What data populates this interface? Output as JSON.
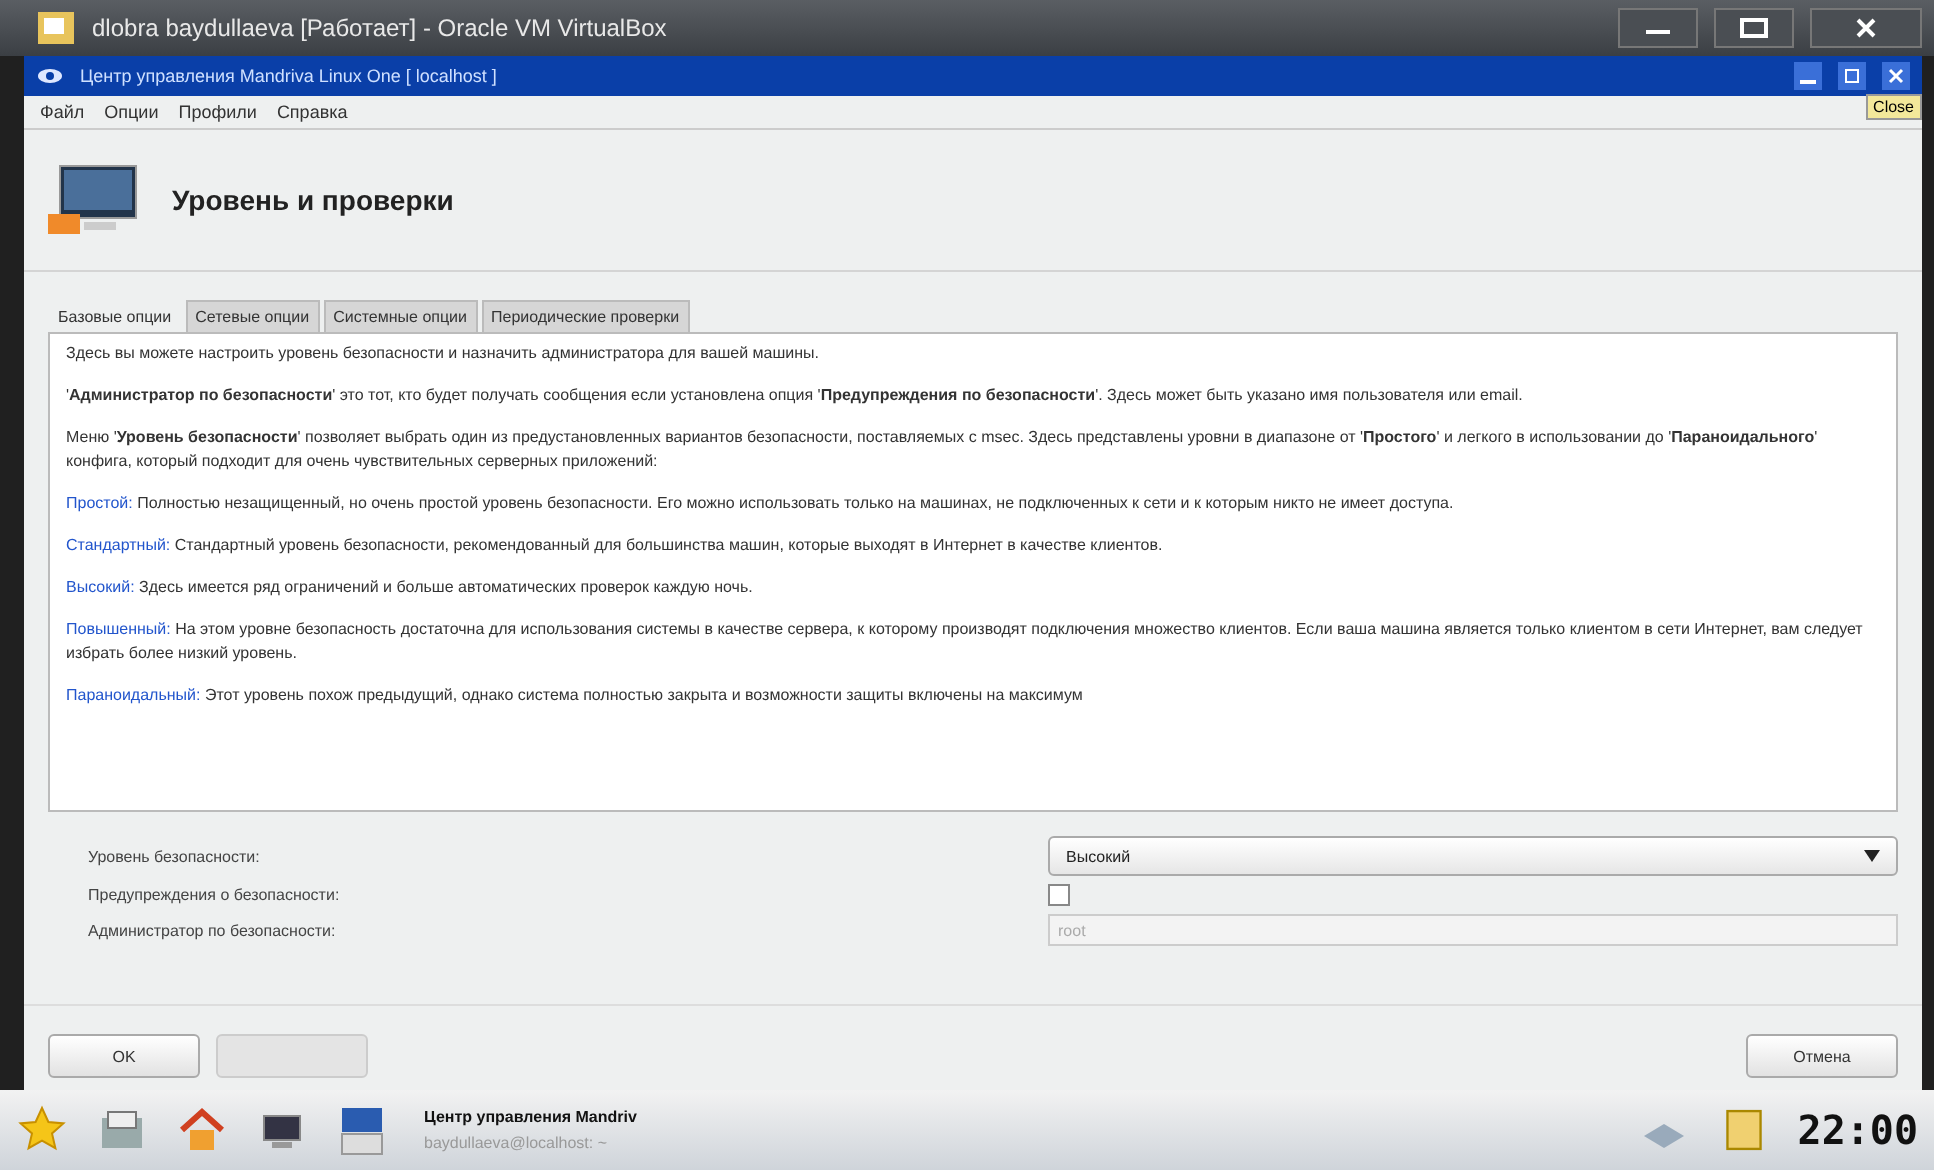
{
  "host_window": {
    "title": "dlobra baydullaeva [Работает] - Oracle VM VirtualBox"
  },
  "window": {
    "title": "Центр управления Mandriva Linux One [ localhost ]",
    "tooltip": "Close"
  },
  "menu": [
    "Файл",
    "Опции",
    "Профили",
    "Справка"
  ],
  "header": {
    "title": "Уровень и проверки"
  },
  "tabs": [
    {
      "label": "Базовые опции",
      "selected": true
    },
    {
      "label": "Сетевые опции",
      "selected": false
    },
    {
      "label": "Системные опции",
      "selected": false
    },
    {
      "label": "Периодические проверки",
      "selected": false
    }
  ],
  "paragraphs": [
    {
      "kind": "text",
      "text": "Здесь вы можете настроить уровень безопасности и назначить администратора для вашей машины."
    },
    {
      "kind": "text",
      "text": "'**Администратор по безопасности**' это тот, кто будет получать сообщения если установлена опция '**Предупреждения по безопасности**'. Здесь может быть указано имя пользователя или email."
    },
    {
      "kind": "text",
      "text": "Меню '**Уровень безопасности**' позволяет выбрать один из предустановленных вариантов безопасности, поставляемых с msec. Здесь представлены уровни в диапазоне от '**Простого**' и легкого в использовании до '**Параноидального**' конфига, который подходит для очень чувствительных серверных приложений:"
    },
    {
      "kind": "level",
      "term": "Простой:",
      "text": "Полностью незащищенный, но очень простой уровень безопасности. Его можно использовать только на машинах, не подключенных к сети и к которым никто не имеет доступа."
    },
    {
      "kind": "level",
      "term": "Стандартный:",
      "text": "Стандартный уровень безопасности, рекомендованный для большинства машин, которые выходят в Интернет в качестве клиентов."
    },
    {
      "kind": "level",
      "term": "Высокий:",
      "text": "Здесь имеется ряд ограничений и больше автоматических проверок каждую ночь."
    },
    {
      "kind": "level",
      "term": "Повышенный:",
      "text": "На этом уровне безопасность достаточна для использования системы в качестве сервера, к которому производят подключения множество клиентов. Если ваша машина является только клиентом в сети Интернет, вам следует избрать более низкий уровень."
    },
    {
      "kind": "level",
      "term": "Параноидальный:",
      "text": "Этот уровень похож предыдущий, однако система полностью закрыта и возможности защиты включены на максимум"
    }
  ],
  "form": [
    {
      "kind": "select",
      "label": "Уровень безопасности:",
      "value": "Высокий"
    },
    {
      "kind": "checkbox",
      "label": "Предупреждения о безопасности:",
      "checked": false
    },
    {
      "kind": "input",
      "label": "Администратор по безопасности:",
      "value": "root",
      "disabled": true
    }
  ],
  "buttons": [
    {
      "label": "OK",
      "disabled": false
    },
    {
      "disabled": true
    },
    {
      "label": "Отмена",
      "disabled": false
    }
  ],
  "taskbar": {
    "tasks": [
      {
        "label": "Центр управления Mandriv",
        "selected": true
      },
      {
        "label": "baydullaeva@localhost: ~",
        "selected": false
      }
    ],
    "clock": "22:00"
  }
}
